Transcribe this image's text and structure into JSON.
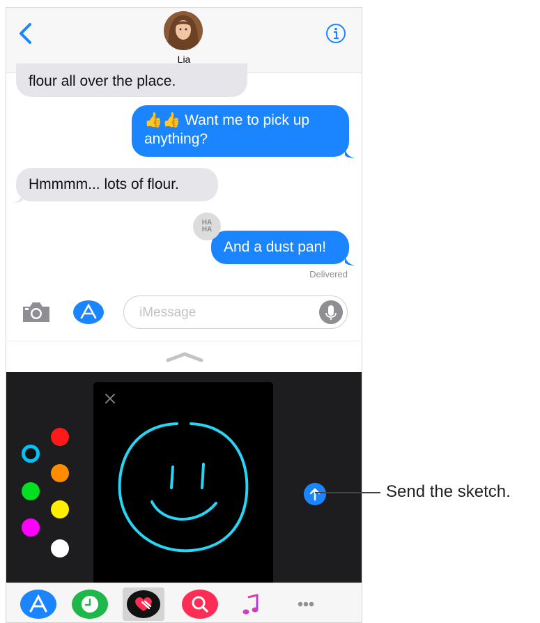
{
  "header": {
    "contact_name": "Lia",
    "back_icon": "chevron-left-icon",
    "info_icon": "info-icon"
  },
  "messages": [
    {
      "direction": "incoming",
      "text": "flour all over the place."
    },
    {
      "direction": "outgoing",
      "text": "👍👍 Want me to pick up anything?"
    },
    {
      "direction": "incoming",
      "text": "Hmmmm... lots of flour."
    },
    {
      "direction": "outgoing",
      "text": "And a dust pan!",
      "tapback": "HA\nHA"
    }
  ],
  "status": {
    "delivered": "Delivered"
  },
  "input": {
    "placeholder": "iMessage"
  },
  "sketch": {
    "colors": [
      "#00c3f5",
      "#ff1a1a",
      "#ff8c00",
      "#00e020",
      "#ffee00",
      "#ff00ff",
      "#ffffff"
    ],
    "selected_color": "#00c3f5"
  },
  "tray": {
    "items": [
      "app-store-icon",
      "clock-icon",
      "digital-touch-icon",
      "image-search-icon",
      "music-icon",
      "more-icon"
    ],
    "selected": "digital-touch-icon"
  },
  "callout": {
    "text": "Send the sketch."
  },
  "colors": {
    "accent": "#1a85ff",
    "incoming_bubble": "#e6e5ea",
    "drawer_bg": "#1d1d1f"
  }
}
